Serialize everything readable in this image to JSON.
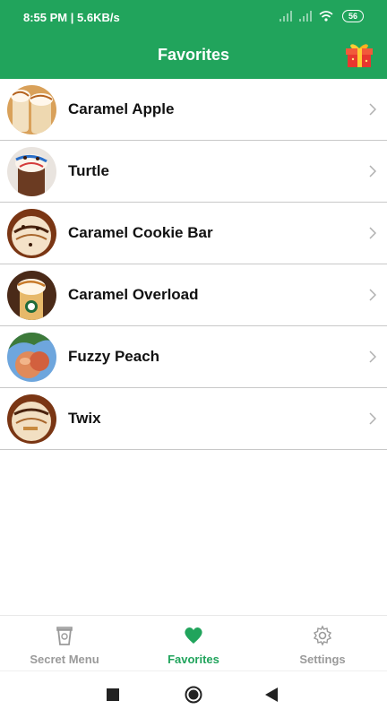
{
  "status_bar": {
    "time": "8:55 PM | 5.6KB/s",
    "battery": "56"
  },
  "header": {
    "title": "Favorites"
  },
  "favorites": [
    {
      "name": "Caramel Apple"
    },
    {
      "name": "Turtle"
    },
    {
      "name": "Caramel Cookie Bar"
    },
    {
      "name": "Caramel Overload"
    },
    {
      "name": "Fuzzy Peach"
    },
    {
      "name": "Twix"
    }
  ],
  "bottom_nav": {
    "tabs": [
      {
        "label": "Secret Menu",
        "icon": "cup-icon"
      },
      {
        "label": "Favorites",
        "icon": "heart-icon"
      },
      {
        "label": "Settings",
        "icon": "gear-icon"
      }
    ],
    "active": "Favorites"
  },
  "colors": {
    "primary": "#21a45c",
    "inactive": "#9a9a9a"
  }
}
